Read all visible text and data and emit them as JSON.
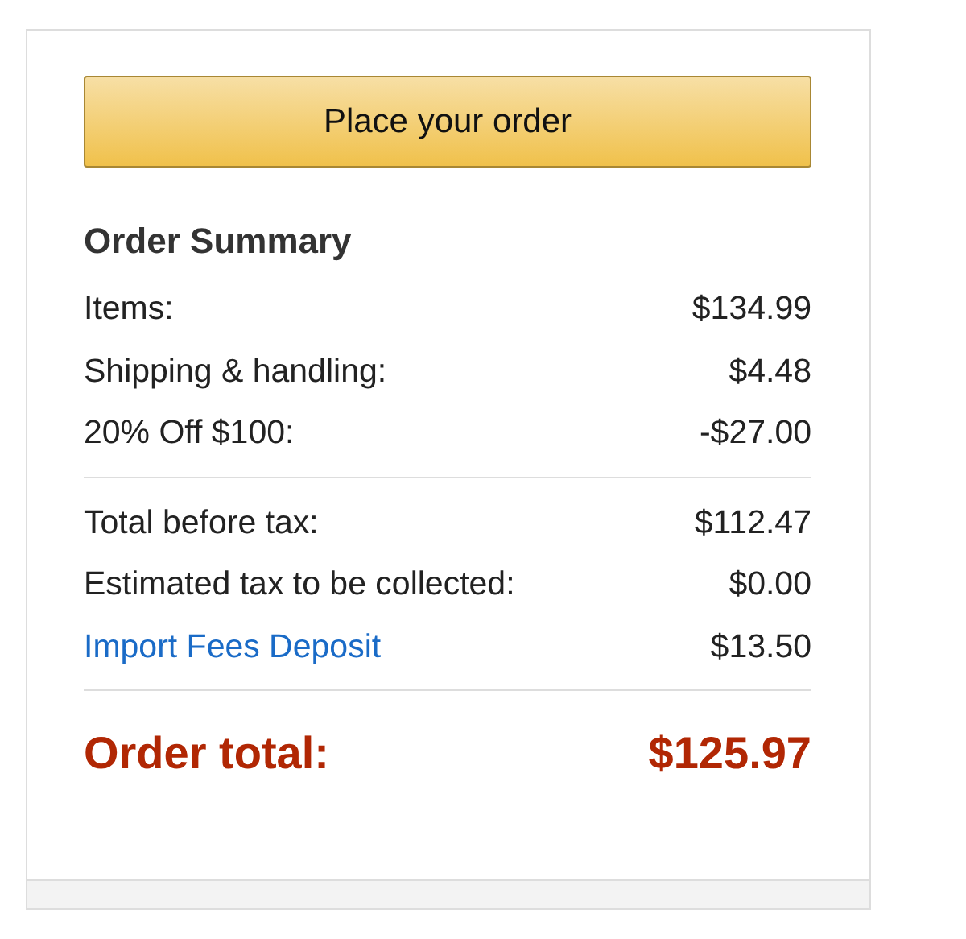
{
  "button": {
    "label": "Place your order"
  },
  "summary": {
    "title": "Order Summary",
    "groups": [
      [
        {
          "label": "Items:",
          "value": "$134.99",
          "kind": "plain"
        },
        {
          "label": "Shipping & handling:",
          "value": "$4.48",
          "kind": "plain"
        },
        {
          "label": "20% Off $100:",
          "value": "-$27.00",
          "kind": "plain"
        }
      ],
      [
        {
          "label": "Total before tax:",
          "value": "$112.47",
          "kind": "plain"
        },
        {
          "label": "Estimated tax to be collected:",
          "value": "$0.00",
          "kind": "plain"
        },
        {
          "label": "Import Fees Deposit",
          "value": "$13.50",
          "kind": "link"
        }
      ]
    ],
    "total": {
      "label": "Order total:",
      "value": "$125.97"
    }
  }
}
